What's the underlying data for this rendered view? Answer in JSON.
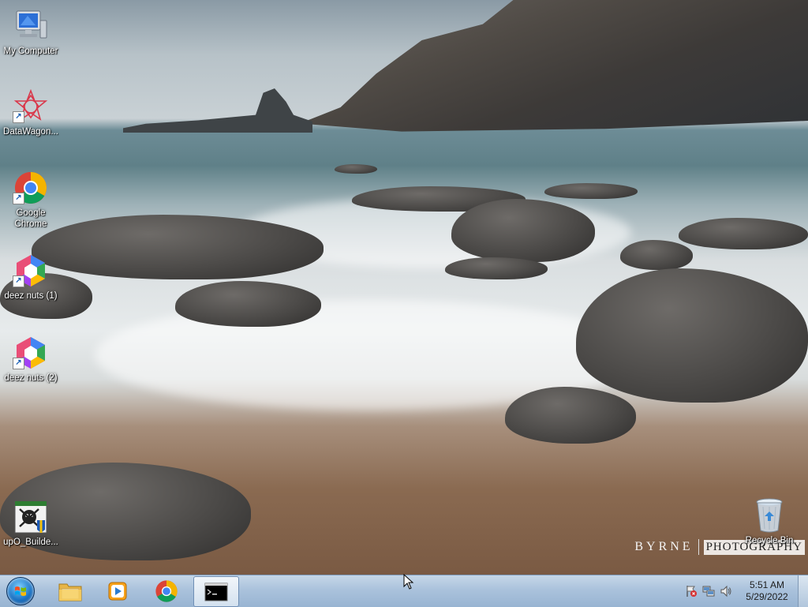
{
  "desktop": {
    "icons": [
      {
        "label": "My Computer",
        "icon": "computer-icon"
      },
      {
        "label": "DataWagon...",
        "icon": "datawagon-icon"
      },
      {
        "label": "Google\nChrome",
        "icon": "chrome-icon"
      },
      {
        "label": "deez nuts (1)",
        "icon": "app-icon"
      },
      {
        "label": "deez nuts (2)",
        "icon": "app-icon"
      },
      {
        "label": "upO_Builde...",
        "icon": "builder-icon"
      },
      {
        "label": "Recycle Bin",
        "icon": "recycle-bin-icon"
      }
    ],
    "watermark": {
      "left": "BYRNE",
      "right": "PHOTOGRAPHY"
    }
  },
  "taskbar": {
    "start": "start-orb",
    "pinned": [
      {
        "name": "file-explorer",
        "icon": "folder-icon"
      },
      {
        "name": "media-player",
        "icon": "media-player-icon"
      },
      {
        "name": "chrome",
        "icon": "chrome-icon"
      },
      {
        "name": "command-prompt",
        "icon": "cmd-icon",
        "active": true
      }
    ],
    "tray": {
      "icons": [
        "action-center-flag-icon",
        "network-icon",
        "volume-icon"
      ],
      "time": "5:51 AM",
      "date": "5/29/2022"
    }
  },
  "colors": {
    "taskbar": "#aac2dc",
    "accent": "#1b73c4"
  }
}
